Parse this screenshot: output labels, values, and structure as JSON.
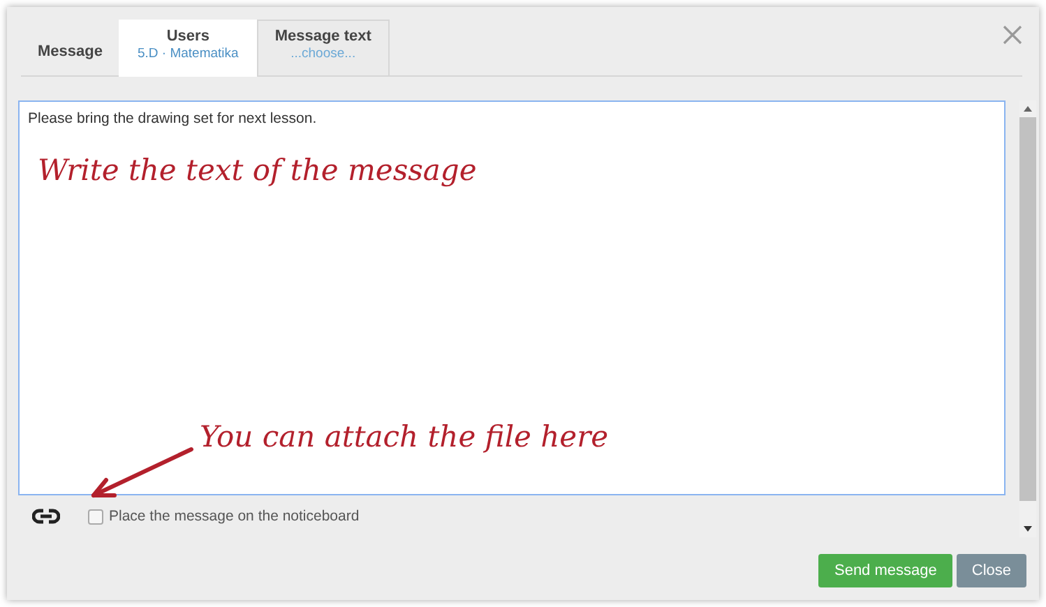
{
  "header": {
    "title": "Message"
  },
  "tabs": [
    {
      "label": "Users",
      "sublabel": "5.D · Matematika",
      "selected": true
    },
    {
      "label": "Message text",
      "sublabel": "...choose...",
      "selected": false
    }
  ],
  "message": {
    "value": "Please bring the drawing set for next lesson."
  },
  "annotations": [
    {
      "text": "Write the text of the message",
      "kind": "plain"
    },
    {
      "text": "You can attach the file here",
      "kind": "arrow"
    }
  ],
  "noticeboard": {
    "label": "Place the message on the noticeboard",
    "checked": false
  },
  "buttons": [
    {
      "label": "Send message",
      "kind": "primary"
    },
    {
      "label": "Close",
      "kind": "secondary"
    }
  ]
}
